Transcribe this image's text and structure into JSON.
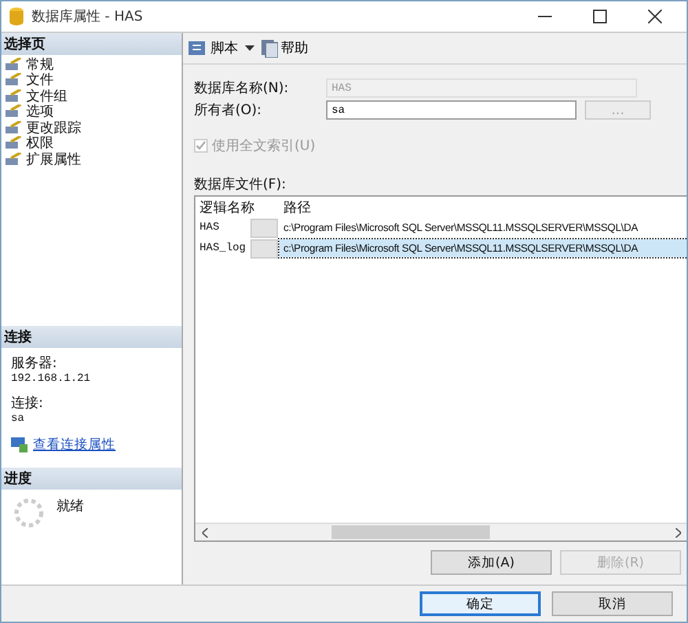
{
  "window": {
    "title": "数据库属性 - HAS"
  },
  "sidebar": {
    "header": "选择页",
    "items": [
      {
        "label": "常规"
      },
      {
        "label": "文件"
      },
      {
        "label": "文件组"
      },
      {
        "label": "选项"
      },
      {
        "label": "更改跟踪"
      },
      {
        "label": "权限"
      },
      {
        "label": "扩展属性"
      }
    ]
  },
  "connection": {
    "header": "连接",
    "server_label": "服务器:",
    "server": "192.168.1.21",
    "connection_label": "连接:",
    "connection": "sa",
    "link": "查看连接属性"
  },
  "progress": {
    "header": "进度",
    "status": "就绪"
  },
  "toolbar": {
    "script": "脚本",
    "help": "帮助"
  },
  "form": {
    "name_label": "数据库名称(N):",
    "name_value": "HAS",
    "name_disabled": true,
    "owner_label": "所有者(O):",
    "owner_value": "sa",
    "browse": "...",
    "browse_disabled": true,
    "fulltext": {
      "label": "使用全文索引(U)",
      "checked": true,
      "disabled": true
    }
  },
  "files": {
    "label": "数据库文件(F):",
    "columns": [
      "逻辑名称",
      "路径"
    ],
    "rows": [
      {
        "name": "HAS",
        "path": "c:\\Program Files\\Microsoft SQL Server\\MSSQL11.MSSQLSERVER\\MSSQL\\DA",
        "selected": false
      },
      {
        "name": "HAS_log",
        "path": "c:\\Program Files\\Microsoft SQL Server\\MSSQL11.MSSQLSERVER\\MSSQL\\DA",
        "selected": true
      }
    ],
    "buttons": [
      {
        "label": "添加(A)",
        "disabled": false
      },
      {
        "label": "删除(R)",
        "disabled": true
      }
    ]
  },
  "footer": {
    "buttons": [
      {
        "label": "确定",
        "default": true
      },
      {
        "label": "取消",
        "default": false
      }
    ]
  }
}
